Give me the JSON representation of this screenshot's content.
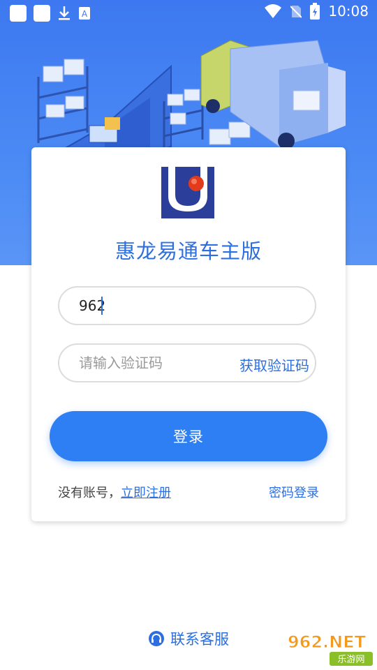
{
  "status_bar": {
    "time": "10:08"
  },
  "app": {
    "title": "惠龙易通车主版"
  },
  "form": {
    "phone_value": "962",
    "code_placeholder": "请输入验证码",
    "get_code_label": "获取验证码",
    "login_label": "登录"
  },
  "footer_links": {
    "no_account": "没有账号，",
    "register": "立即注册",
    "password_login": "密码登录"
  },
  "contact": {
    "label": "联系客服"
  },
  "watermark": {
    "brand": "962.NET",
    "sub": "乐游网"
  },
  "colors": {
    "primary": "#2f7ff4",
    "hero": "#3d78f0",
    "text_accent": "#2c6fe0"
  },
  "icons": [
    "download-icon",
    "text-a-icon",
    "wifi-icon",
    "no-sim-icon",
    "battery-icon",
    "headset-icon"
  ]
}
